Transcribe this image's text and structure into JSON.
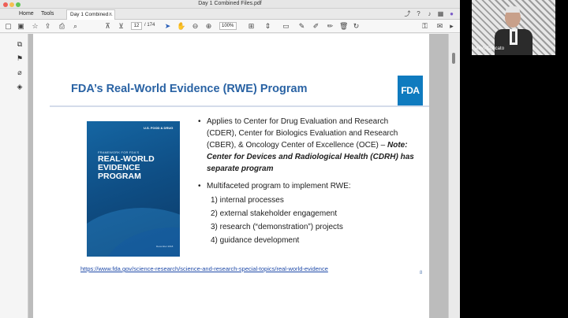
{
  "window": {
    "title": "Day 1 Combined Files.pdf"
  },
  "tabs": {
    "home": "Home",
    "tools": "Tools",
    "document": "Day 1 Combined...",
    "close": "×"
  },
  "toolbar": {
    "page_current": "12",
    "page_total": "/ 174",
    "zoom": "100%"
  },
  "slide": {
    "title": "FDA’s Real-World Evidence (RWE) Program",
    "logo_text": "FDA",
    "cover": {
      "agency": "U.S. FOOD & DRUG",
      "small_title": "FRAMEWORK FOR FDA'S",
      "big_title": "REAL-WORLD EVIDENCE PROGRAM",
      "footer": "December 2018"
    },
    "bullet1_plain": "Applies to Center for Drug Evaluation and Research (CDER), Center for Biologics Evaluation and Research (CBER), & Oncology Center of Excellence (OCE) – ",
    "bullet1_note": "Note: Center for Devices and Radiological Health (CDRH) has separate program",
    "bullet2": "Multifaceted program to implement RWE:",
    "sub_items": [
      "1) internal processes",
      "2) external stakeholder engagement",
      "3) research (“demonstration”) projects",
      "4) guidance development"
    ],
    "link": "https://www.fda.gov/science-research/science-and-research-special-topics/real-world-evidence",
    "number": "8"
  },
  "video": {
    "name": "John Concato"
  }
}
